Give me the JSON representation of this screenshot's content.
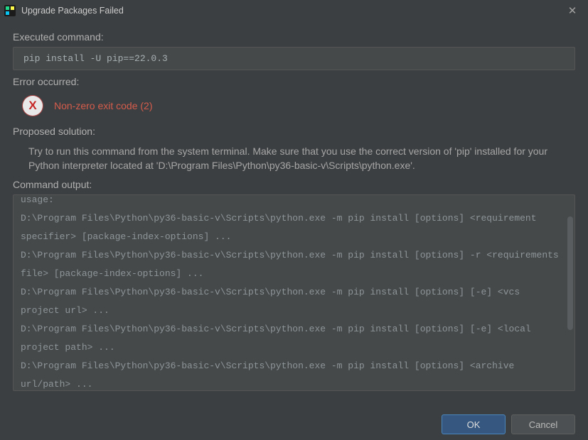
{
  "titlebar": {
    "title": "Upgrade Packages Failed"
  },
  "sections": {
    "executed_label": "Executed command:",
    "executed_command": "pip install -U pip==22.0.3",
    "error_label": "Error occurred:",
    "error_message": "Non-zero exit code (2)",
    "solution_label": "Proposed solution:",
    "solution_text": "Try to run this command from the system terminal. Make sure that you use the correct version of 'pip' installed for your Python interpreter located at 'D:\\Program Files\\Python\\py36-basic-v\\Scripts\\python.exe'.",
    "output_label": "Command output:"
  },
  "output_lines": {
    "l0": "usage:",
    "l1": "  D:\\Program Files\\Python\\py36-basic-v\\Scripts\\python.exe -m pip install [options] <requirement specifier> [package-index-options] ...",
    "l2": "  D:\\Program Files\\Python\\py36-basic-v\\Scripts\\python.exe -m pip install [options] -r <requirements file> [package-index-options] ...",
    "l3": "  D:\\Program Files\\Python\\py36-basic-v\\Scripts\\python.exe -m pip install [options] [-e] <vcs project url> ...",
    "l4": "  D:\\Program Files\\Python\\py36-basic-v\\Scripts\\python.exe -m pip install [options] [-e] <local project path> ...",
    "l5": "  D:\\Program Files\\Python\\py36-basic-v\\Scripts\\python.exe -m pip install [options] <archive url/path> ..."
  },
  "buttons": {
    "ok": "OK",
    "cancel": "Cancel"
  },
  "icons": {
    "error_glyph": "X",
    "close_glyph": "✕"
  }
}
